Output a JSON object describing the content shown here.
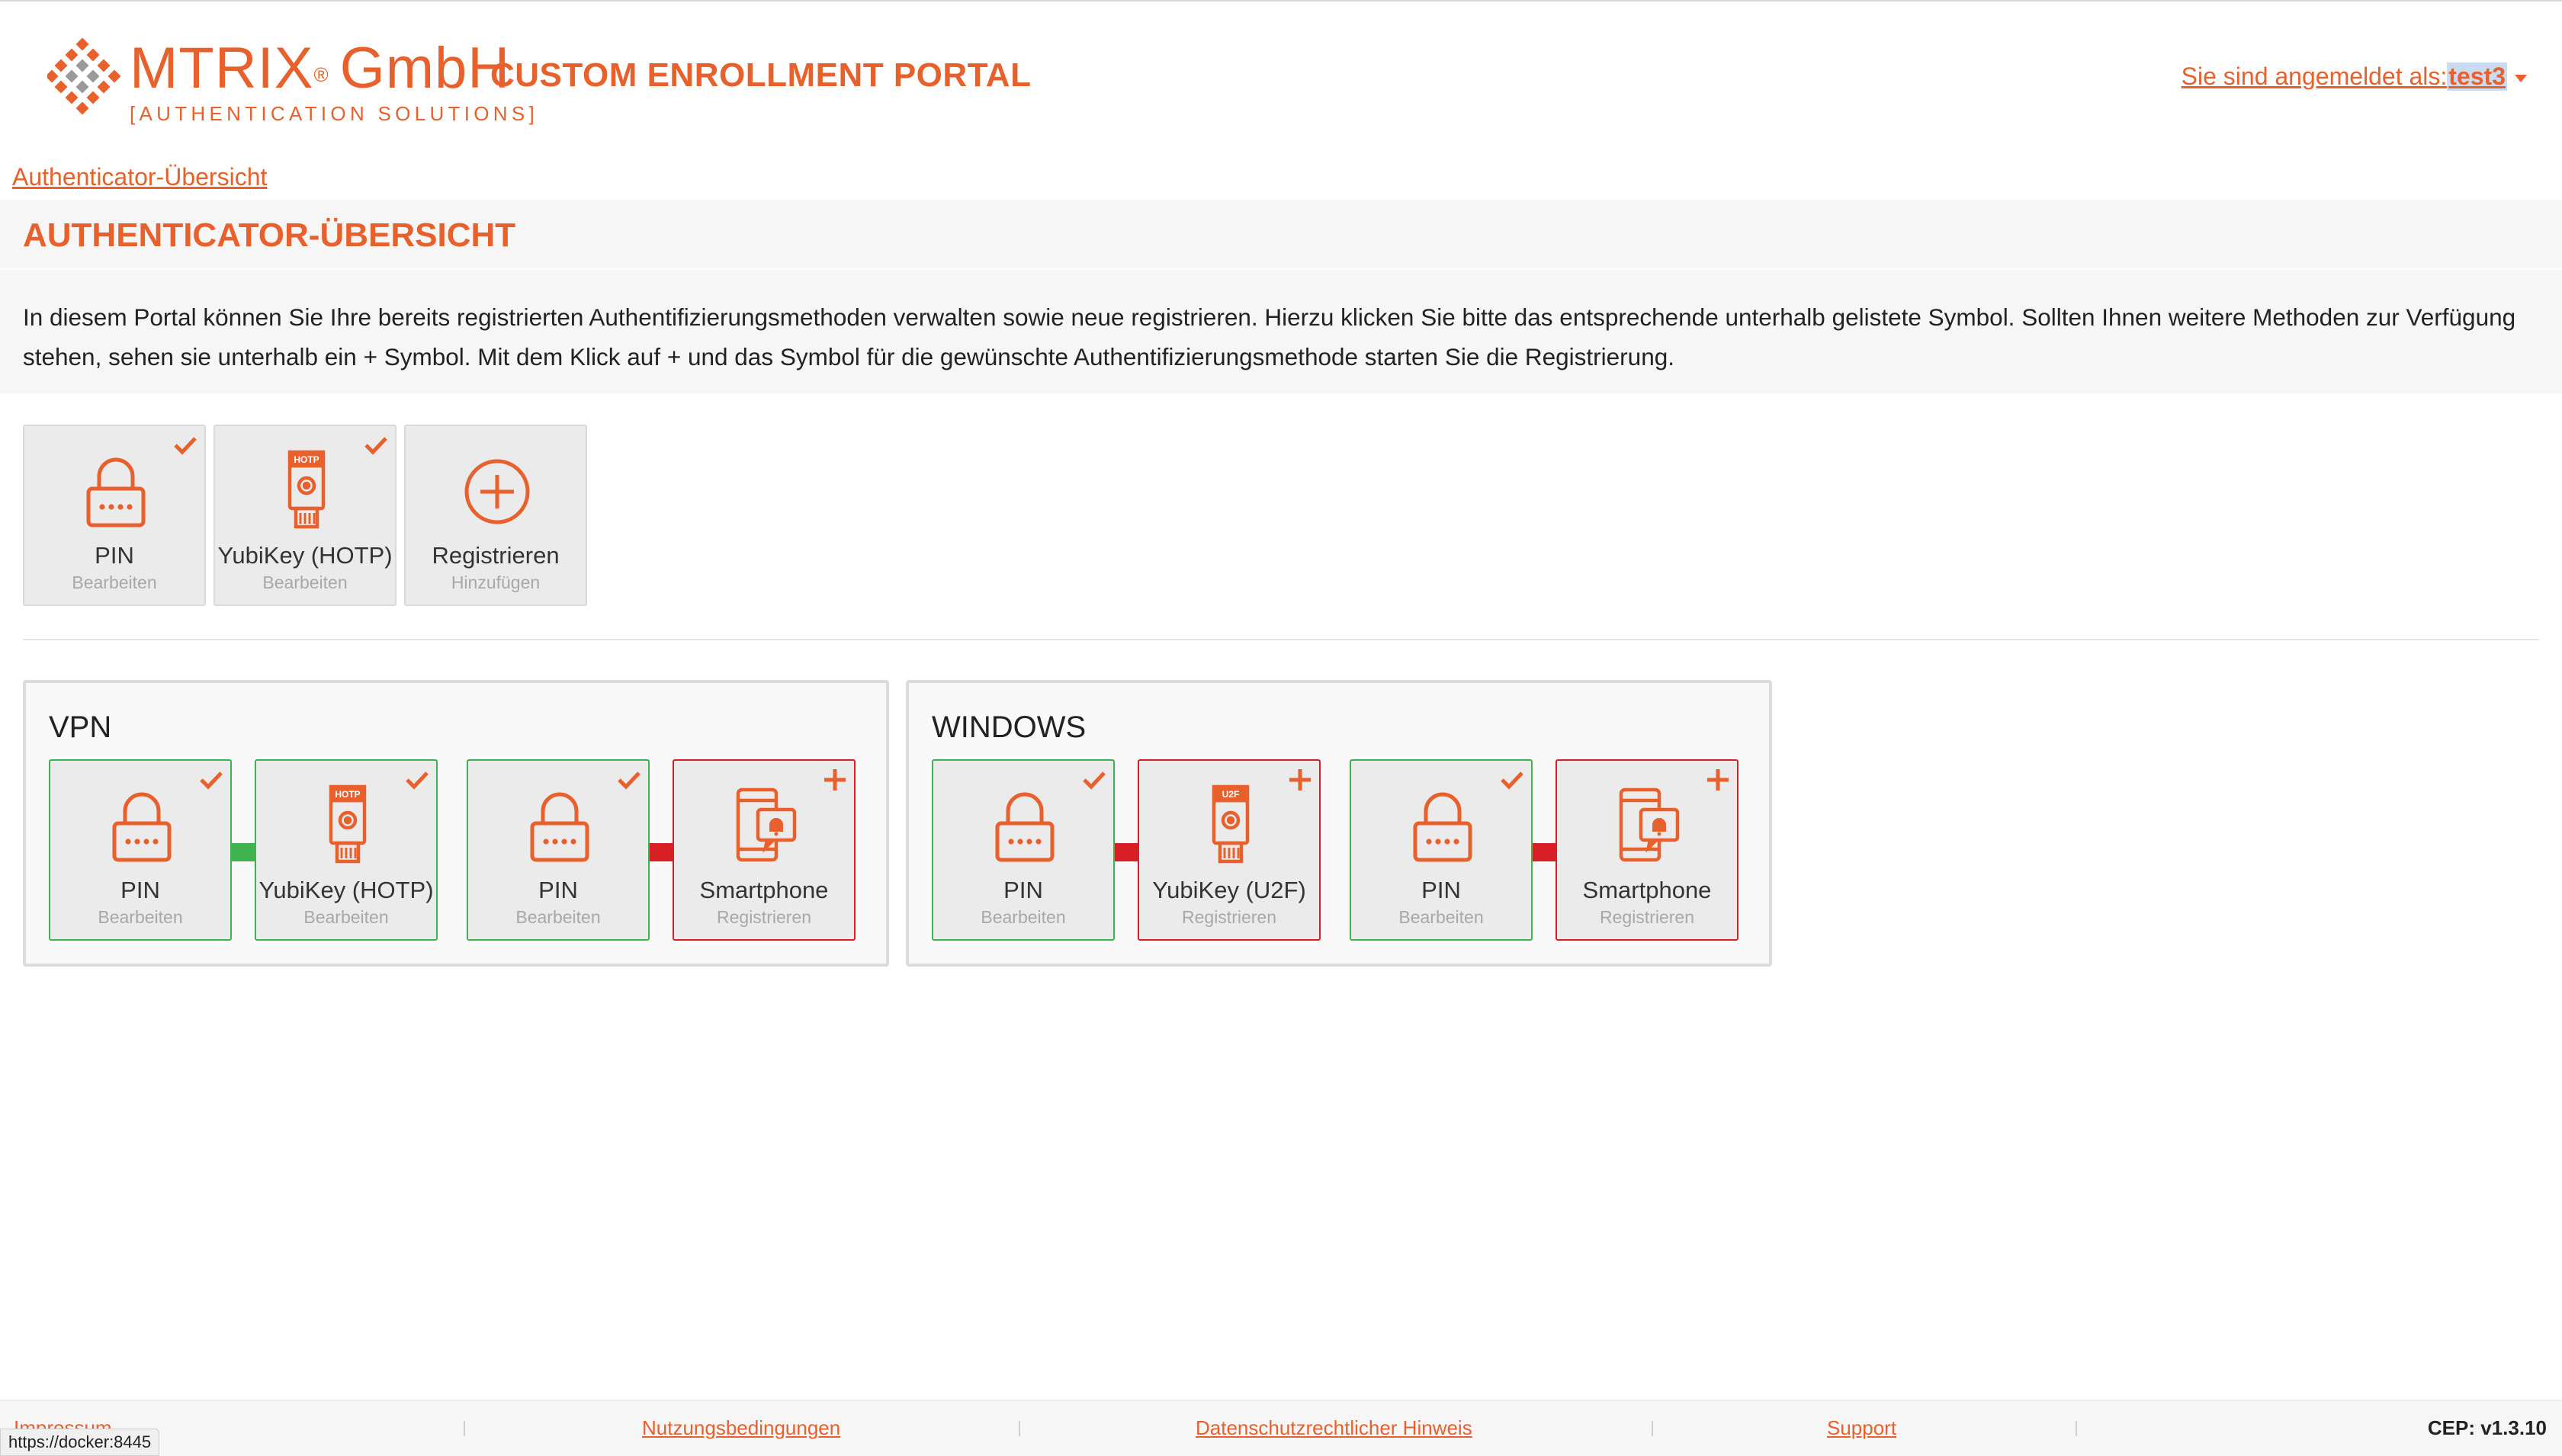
{
  "header": {
    "brand_name": "MTRIX",
    "brand_reg": "®",
    "brand_suffix": "GmbH",
    "brand_sub": "[AUTHENTICATION SOLUTIONS]",
    "portal_title": "CUSTOM ENROLLMENT PORTAL",
    "user_prefix": "Sie sind angemeldet als: ",
    "user_name": "test3"
  },
  "breadcrumb": "Authenticator-Übersicht",
  "page": {
    "title": "AUTHENTICATOR-ÜBERSICHT",
    "description": "In diesem Portal können Sie Ihre bereits registrierten Authentifizierungsmethoden verwalten sowie neue registrieren. Hierzu klicken Sie bitte das entsprechende unterhalb gelistete Symbol. Sollten Ihnen weitere Methoden zur Verfügung stehen, sehen sie unterhalb ein + Symbol. Mit dem Klick auf + und das Symbol für die gewünschte Authentifizierungsmethode starten Sie die Registrierung."
  },
  "overview_tiles": [
    {
      "label": "PIN",
      "sub": "Bearbeiten",
      "icon": "lock-icon",
      "badge": "check"
    },
    {
      "label": "YubiKey (HOTP)",
      "sub": "Bearbeiten",
      "icon": "yubikey-hotp-icon",
      "badge": "check",
      "icon_tag": "HOTP"
    },
    {
      "label": "Registrieren",
      "sub": "Hinzufügen",
      "icon": "add-circle-icon",
      "badge": "none"
    }
  ],
  "groups": [
    {
      "title": "VPN",
      "tiles": [
        {
          "label": "PIN",
          "sub": "Bearbeiten",
          "icon": "lock-icon",
          "badge": "check",
          "state": "green"
        },
        {
          "label": "YubiKey (HOTP)",
          "sub": "Bearbeiten",
          "icon": "yubikey-hotp-icon",
          "badge": "check",
          "state": "green",
          "icon_tag": "HOTP"
        },
        {
          "label": "PIN",
          "sub": "Bearbeiten",
          "icon": "lock-icon",
          "badge": "check",
          "state": "green"
        },
        {
          "label": "Smartphone",
          "sub": "Registrieren",
          "icon": "smartphone-icon",
          "badge": "plus",
          "state": "red"
        }
      ]
    },
    {
      "title": "WINDOWS",
      "tiles": [
        {
          "label": "PIN",
          "sub": "Bearbeiten",
          "icon": "lock-icon",
          "badge": "check",
          "state": "green"
        },
        {
          "label": "YubiKey (U2F)",
          "sub": "Registrieren",
          "icon": "yubikey-u2f-icon",
          "badge": "plus",
          "state": "red",
          "icon_tag": "U2F"
        },
        {
          "label": "PIN",
          "sub": "Bearbeiten",
          "icon": "lock-icon",
          "badge": "check",
          "state": "green"
        },
        {
          "label": "Smartphone",
          "sub": "Registrieren",
          "icon": "smartphone-icon",
          "badge": "plus",
          "state": "red"
        }
      ]
    }
  ],
  "footer": {
    "links": [
      "Impressum",
      "Nutzungsbedingungen",
      "Datenschutzrechtlicher Hinweis",
      "Support"
    ],
    "version": "CEP: v1.3.10"
  },
  "status_url": "https://docker:8445",
  "colors": {
    "accent": "#e8602c",
    "success": "#3fb34f",
    "danger": "#d81f26"
  }
}
